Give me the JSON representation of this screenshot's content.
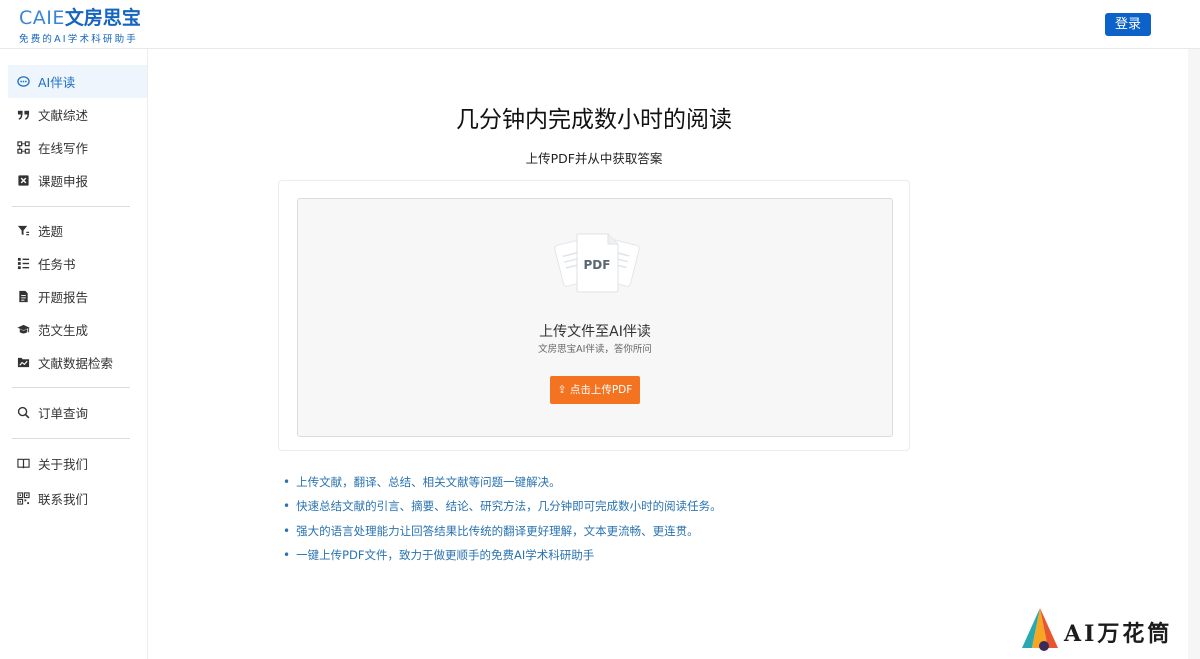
{
  "header": {
    "logo_brand": "CAIE",
    "logo_name": "文房思宝",
    "logo_tagline": "免费的AI学术科研助手",
    "login_label": "登录"
  },
  "sidebar": {
    "groups": [
      [
        {
          "label": "AI伴读",
          "icon": "chat-bubble-icon",
          "active": true
        },
        {
          "label": "文献综述",
          "icon": "quote-icon"
        },
        {
          "label": "在线写作",
          "icon": "nodes-icon"
        },
        {
          "label": "课题申报",
          "icon": "cancel-box-icon"
        }
      ],
      [
        {
          "label": "选题",
          "icon": "filter-icon"
        },
        {
          "label": "任务书",
          "icon": "list-icon"
        },
        {
          "label": "开题报告",
          "icon": "document-icon"
        },
        {
          "label": "范文生成",
          "icon": "graduation-cap-icon"
        },
        {
          "label": "文献数据检索",
          "icon": "chart-folder-icon"
        }
      ],
      [
        {
          "label": "订单查询",
          "icon": "search-icon"
        }
      ],
      [
        {
          "label": "关于我们",
          "icon": "book-icon"
        },
        {
          "label": "联系我们",
          "icon": "qr-code-icon"
        }
      ]
    ]
  },
  "main": {
    "title": "几分钟内完成数小时的阅读",
    "subtitle": "上传PDF并从中获取答案",
    "upload": {
      "pdf_label": "PDF",
      "title": "上传文件至AI伴读",
      "hint": "文房思宝AI伴读，答你所问",
      "button_label": "点击上传PDF"
    },
    "features": [
      "上传文献，翻译、总结、相关文献等问题一键解决。",
      "快速总结文献的引言、摘要、结论、研究方法，几分钟即可完成数小时的阅读任务。",
      "强大的语言处理能力让回答结果比传统的翻译更好理解，文本更流畅、更连贯。",
      "一键上传PDF文件，致力于做更顺手的免费AI学术科研助手"
    ]
  },
  "watermark": {
    "text": "AI万花筒"
  },
  "colors": {
    "accent": "#0d62c9",
    "upload_button": "#f47320",
    "feature_text": "#2a73b0",
    "active_nav_bg": "#eef5fc"
  }
}
